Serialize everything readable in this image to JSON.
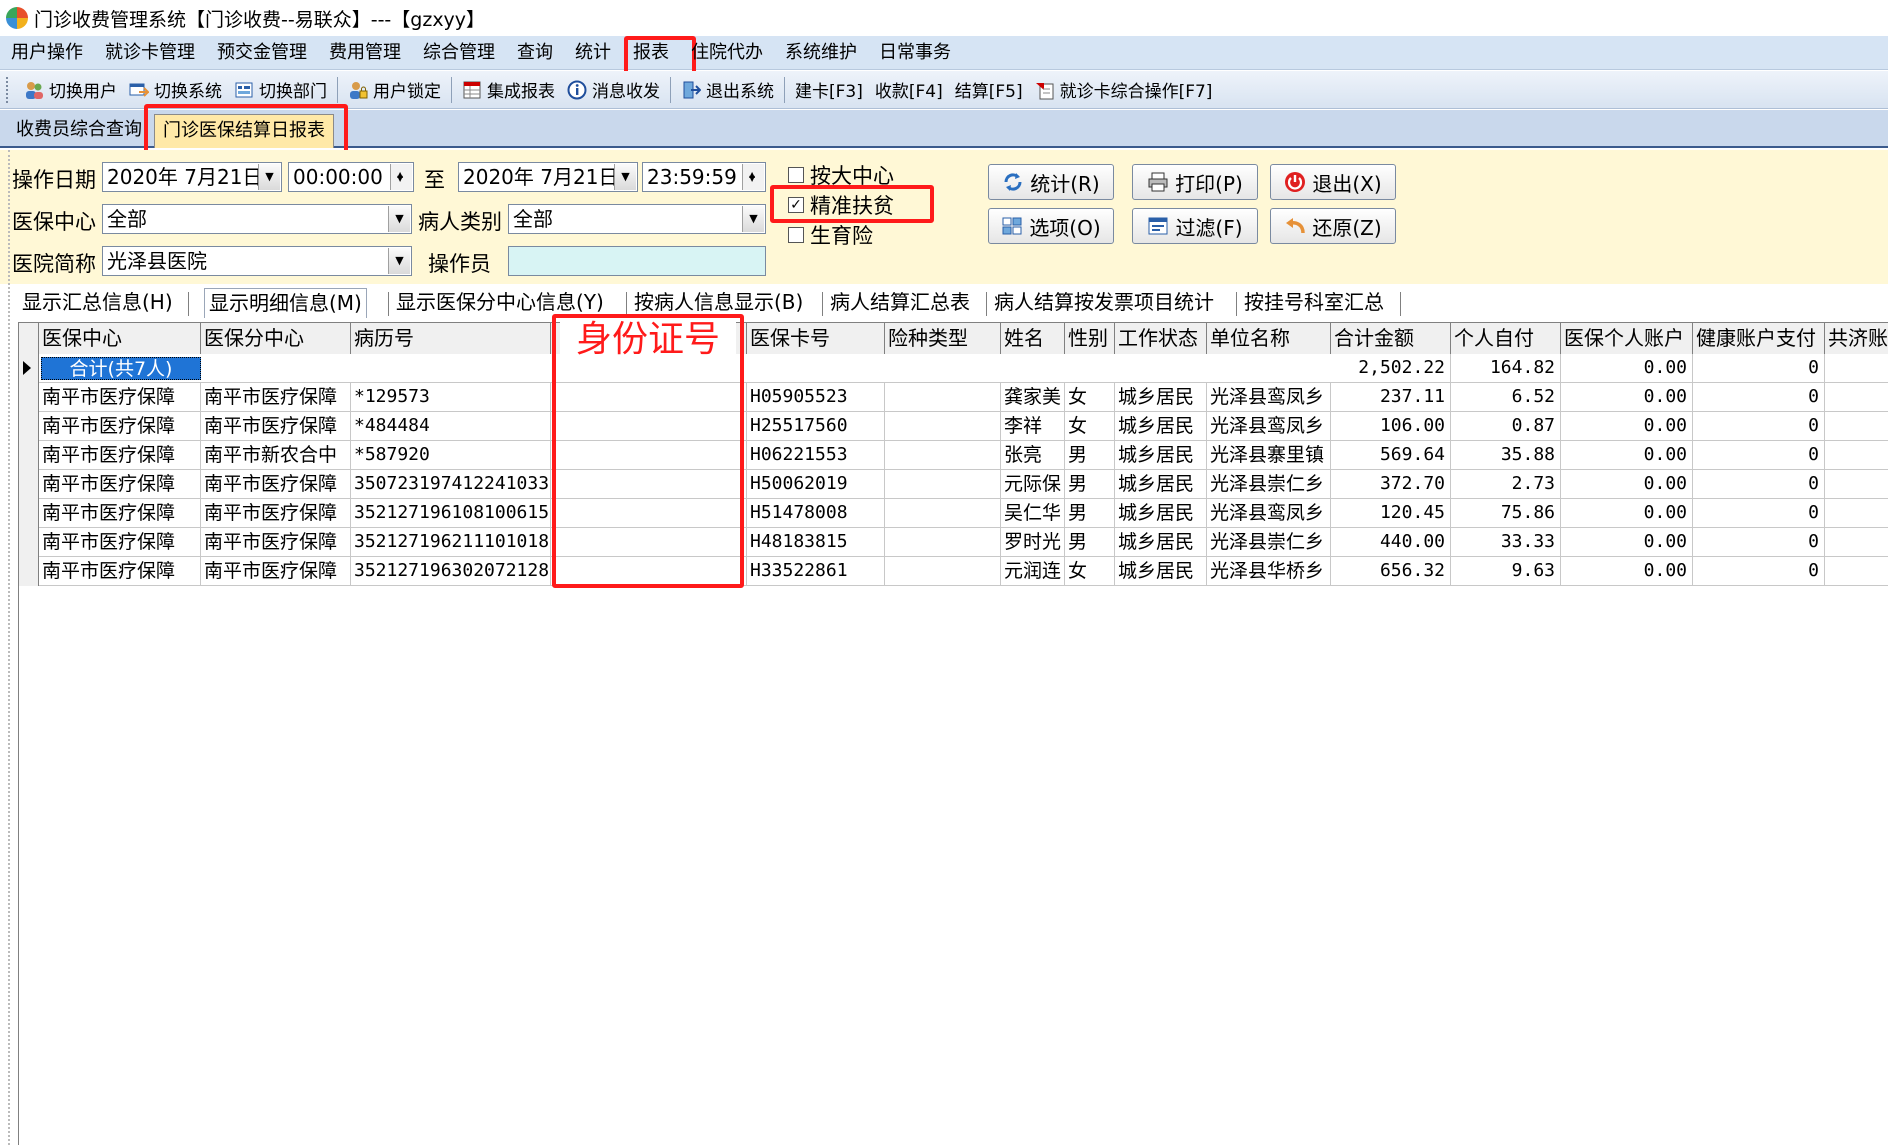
{
  "window": {
    "title": "门诊收费管理系统【门诊收费--易联众】---【gzxyy】"
  },
  "menu": [
    "用户操作",
    "就诊卡管理",
    "预交金管理",
    "费用管理",
    "综合管理",
    "查询",
    "统计",
    "报表",
    "住院代办",
    "系统维护",
    "日常事务"
  ],
  "toolbar": [
    "切换用户",
    "切换系统",
    "切换部门",
    "用户锁定",
    "集成报表",
    "消息收发",
    "退出系统",
    "建卡[F3]",
    "收款[F4]",
    "结算[F5]",
    "就诊卡综合操作[F7]"
  ],
  "tabs": [
    "收费员综合查询",
    "门诊医保结算日报表"
  ],
  "form": {
    "op_date_label": "操作日期",
    "date_from": "2020年  7月21日",
    "time_from": "00:00:00",
    "to_label": "至",
    "date_to": "2020年  7月21日",
    "time_to": "23:59:59",
    "center_label": "医保中心",
    "center_value": "全部",
    "ptype_label": "病人类别",
    "ptype_value": "全部",
    "hosp_label": "医院简称",
    "hosp_value": "光泽县医院",
    "operator_label": "操作员",
    "operator_value": ""
  },
  "checks": [
    {
      "label": "按大中心",
      "checked": false
    },
    {
      "label": "精准扶贫",
      "checked": true
    },
    {
      "label": "生育险",
      "checked": false
    }
  ],
  "buttons": {
    "stat": "统计(R)",
    "print": "打印(P)",
    "exit": "退出(X)",
    "options": "选项(O)",
    "filter": "过滤(F)",
    "restore": "还原(Z)"
  },
  "subtabs": [
    "显示汇总信息(H)",
    "显示明细信息(M)",
    "显示医保分中心信息(Y)",
    "按病人信息显示(B)",
    "病人结算汇总表",
    "病人结算按发票项目统计",
    "按挂号科室汇总"
  ],
  "grid": {
    "headers": [
      "医保中心",
      "医保分中心",
      "病历号",
      "",
      "医保卡号",
      "险种类型",
      "姓名",
      "性别",
      "工作状态",
      "单位名称",
      "合计金额",
      "个人自付",
      "医保个人账户",
      "健康账户支付",
      "共济账"
    ],
    "total_label": "合计(共7人)",
    "total_row": {
      "total": "2,502.22",
      "self": "164.82",
      "acct": "0.00",
      "health": "0"
    },
    "rows": [
      [
        "南平市医疗保障",
        "南平市医疗保障",
        "*129573",
        "",
        "H05905523",
        "",
        "龚家美",
        "女",
        "城乡居民",
        "光泽县鸾凤乡",
        "237.11",
        "6.52",
        "0.00",
        "0"
      ],
      [
        "南平市医疗保障",
        "南平市医疗保障",
        "*484484",
        "",
        "H25517560",
        "",
        "李祥",
        "女",
        "城乡居民",
        "光泽县鸾凤乡",
        "106.00",
        "0.87",
        "0.00",
        "0"
      ],
      [
        "南平市医疗保障",
        "南平市新农合中",
        "*587920",
        "",
        "H06221553",
        "",
        "张亮",
        "男",
        "城乡居民",
        "光泽县寨里镇",
        "569.64",
        "35.88",
        "0.00",
        "0"
      ],
      [
        "南平市医疗保障",
        "南平市医疗保障",
        "350723197412241033",
        "",
        "H50062019",
        "",
        "元际保",
        "男",
        "城乡居民",
        "光泽县崇仁乡",
        "372.70",
        "2.73",
        "0.00",
        "0"
      ],
      [
        "南平市医疗保障",
        "南平市医疗保障",
        "352127196108100615",
        "",
        "H51478008",
        "",
        "吴仁华",
        "男",
        "城乡居民",
        "光泽县鸾凤乡",
        "120.45",
        "75.86",
        "0.00",
        "0"
      ],
      [
        "南平市医疗保障",
        "南平市医疗保障",
        "352127196211101018",
        "",
        "H48183815",
        "",
        "罗时光",
        "男",
        "城乡居民",
        "光泽县崇仁乡",
        "440.00",
        "33.33",
        "0.00",
        "0"
      ],
      [
        "南平市医疗保障",
        "南平市医疗保障",
        "352127196302072128",
        "",
        "H33522861",
        "",
        "元润连",
        "女",
        "城乡居民",
        "光泽县华桥乡",
        "656.32",
        "9.63",
        "0.00",
        "0"
      ]
    ]
  },
  "annotation": {
    "id_label": "身份证号"
  },
  "colors": {
    "highlight": "#ff1a1a",
    "panel_bg": "#fff8d6",
    "menubar_bg": "#d6e4f4",
    "selected_cell": "#1f74d6"
  }
}
